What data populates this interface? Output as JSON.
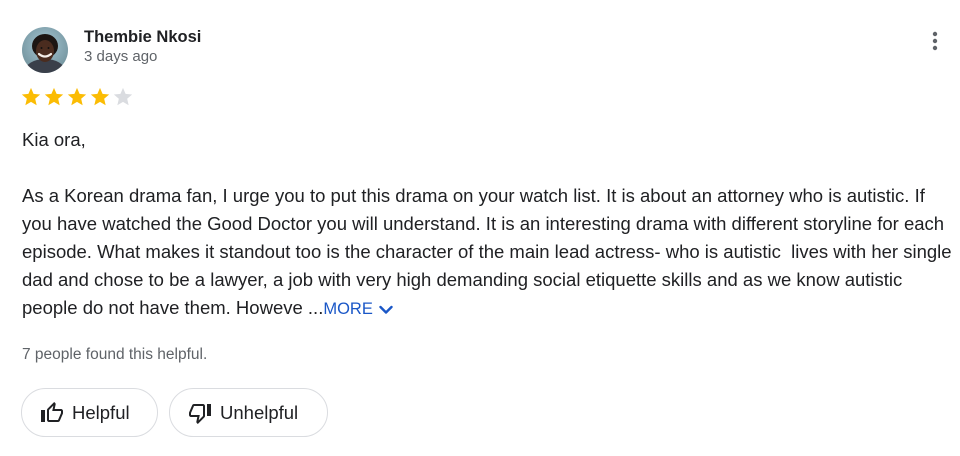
{
  "review": {
    "author": "Thembie Nkosi",
    "timestamp": "3 days ago",
    "rating": 4,
    "rating_max": 5,
    "greeting": "Kia ora,",
    "body": "As a Korean drama fan, I urge you to put this drama on your watch list. It is about an attorney who is autistic. If you have watched the Good Doctor you will understand. It is an interesting drama with different storyline for each episode. What makes it standout too is the character of the main lead actress- who is autistic  lives with her single dad and chose to be a lawyer, a job with very high demanding social etiquette skills and as we know autistic people do not have them. Howeve ...",
    "more_label": "MORE",
    "helpful_count_text": "7 people found this helpful."
  },
  "actions": {
    "helpful_label": "Helpful",
    "unhelpful_label": "Unhelpful"
  },
  "icons": {
    "avatar": "avatar",
    "more_options": "vertical-dots-icon",
    "star_filled": "star-filled-icon",
    "star_empty": "star-empty-icon",
    "more_chevron": "chevron-down-icon",
    "helpful": "thumbs-up-icon",
    "unhelpful": "thumbs-down-icon"
  },
  "colors": {
    "star_filled": "#fbbc04",
    "star_empty": "#dadce0",
    "link": "#1a57c7",
    "secondary_text": "#5f6368",
    "border": "#dadce0"
  }
}
